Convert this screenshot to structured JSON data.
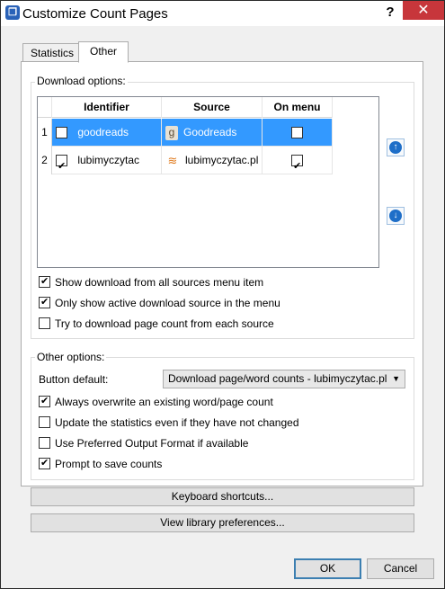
{
  "window": {
    "title": "Customize Count Pages",
    "help": "?",
    "close": "✕",
    "app_icon": "book-icon"
  },
  "tabs": [
    {
      "label": "Statistics"
    },
    {
      "label": "Other"
    }
  ],
  "download_options": {
    "group_title": "Download options:",
    "columns": [
      "Identifier",
      "Source",
      "On menu"
    ],
    "rows": [
      {
        "num": "1",
        "enabled": false,
        "identifier": "goodreads",
        "source": "Goodreads",
        "source_icon": "goodreads-icon",
        "on_menu": false,
        "selected": true
      },
      {
        "num": "2",
        "enabled": true,
        "identifier": "lubimyczytac",
        "source": "lubimyczytac.pl",
        "source_icon": "books-stack-icon",
        "on_menu": true,
        "selected": false
      }
    ],
    "move_up": "arrow-up-icon",
    "move_down": "arrow-down-icon",
    "checkboxes": [
      {
        "label": "Show download from all sources menu item",
        "checked": true
      },
      {
        "label": "Only show active download source in the menu",
        "checked": true
      },
      {
        "label": "Try to download page count from each source",
        "checked": false
      }
    ]
  },
  "other_options": {
    "group_title": "Other options:",
    "button_default_label": "Button default:",
    "button_default_value": "Download page/word counts - lubimyczytac.pl",
    "checkboxes": [
      {
        "label": "Always overwrite an existing word/page count",
        "checked": true
      },
      {
        "label": "Update the statistics even if they have not changed",
        "checked": false
      },
      {
        "label": "Use Preferred Output Format if available",
        "checked": false
      },
      {
        "label": "Prompt to save counts",
        "checked": true
      }
    ]
  },
  "buttons": {
    "keyboard_shortcuts": "Keyboard shortcuts...",
    "view_library_preferences": "View library preferences...",
    "ok": "OK",
    "cancel": "Cancel"
  }
}
